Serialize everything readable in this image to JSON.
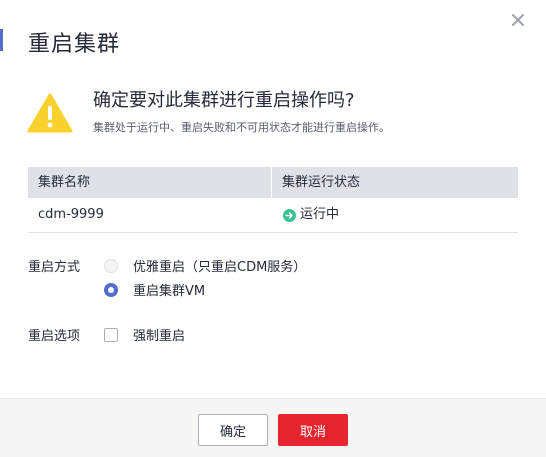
{
  "dialog": {
    "title": "重启集群",
    "question": "确定要对此集群进行重启操作吗?",
    "note": "集群处于运行中、重启失败和不可用状态才能进行重启操作。"
  },
  "table": {
    "headers": [
      "集群名称",
      "集群运行状态"
    ],
    "rows": [
      {
        "name": "cdm-9999",
        "status": "运行中"
      }
    ]
  },
  "restart_mode": {
    "label": "重启方式",
    "options": [
      {
        "label": "优雅重启（只重启CDM服务）",
        "checked": false,
        "disabled": true
      },
      {
        "label": "重启集群VM",
        "checked": true,
        "disabled": false
      }
    ]
  },
  "restart_option": {
    "label": "重启选项",
    "checkbox_label": "强制重启",
    "checked": false
  },
  "footer": {
    "ok_label": "确定",
    "cancel_label": "取消"
  },
  "colors": {
    "accent": "#526ecc",
    "danger": "#e6252e",
    "warning": "#f8d12e",
    "success": "#3ac295"
  }
}
